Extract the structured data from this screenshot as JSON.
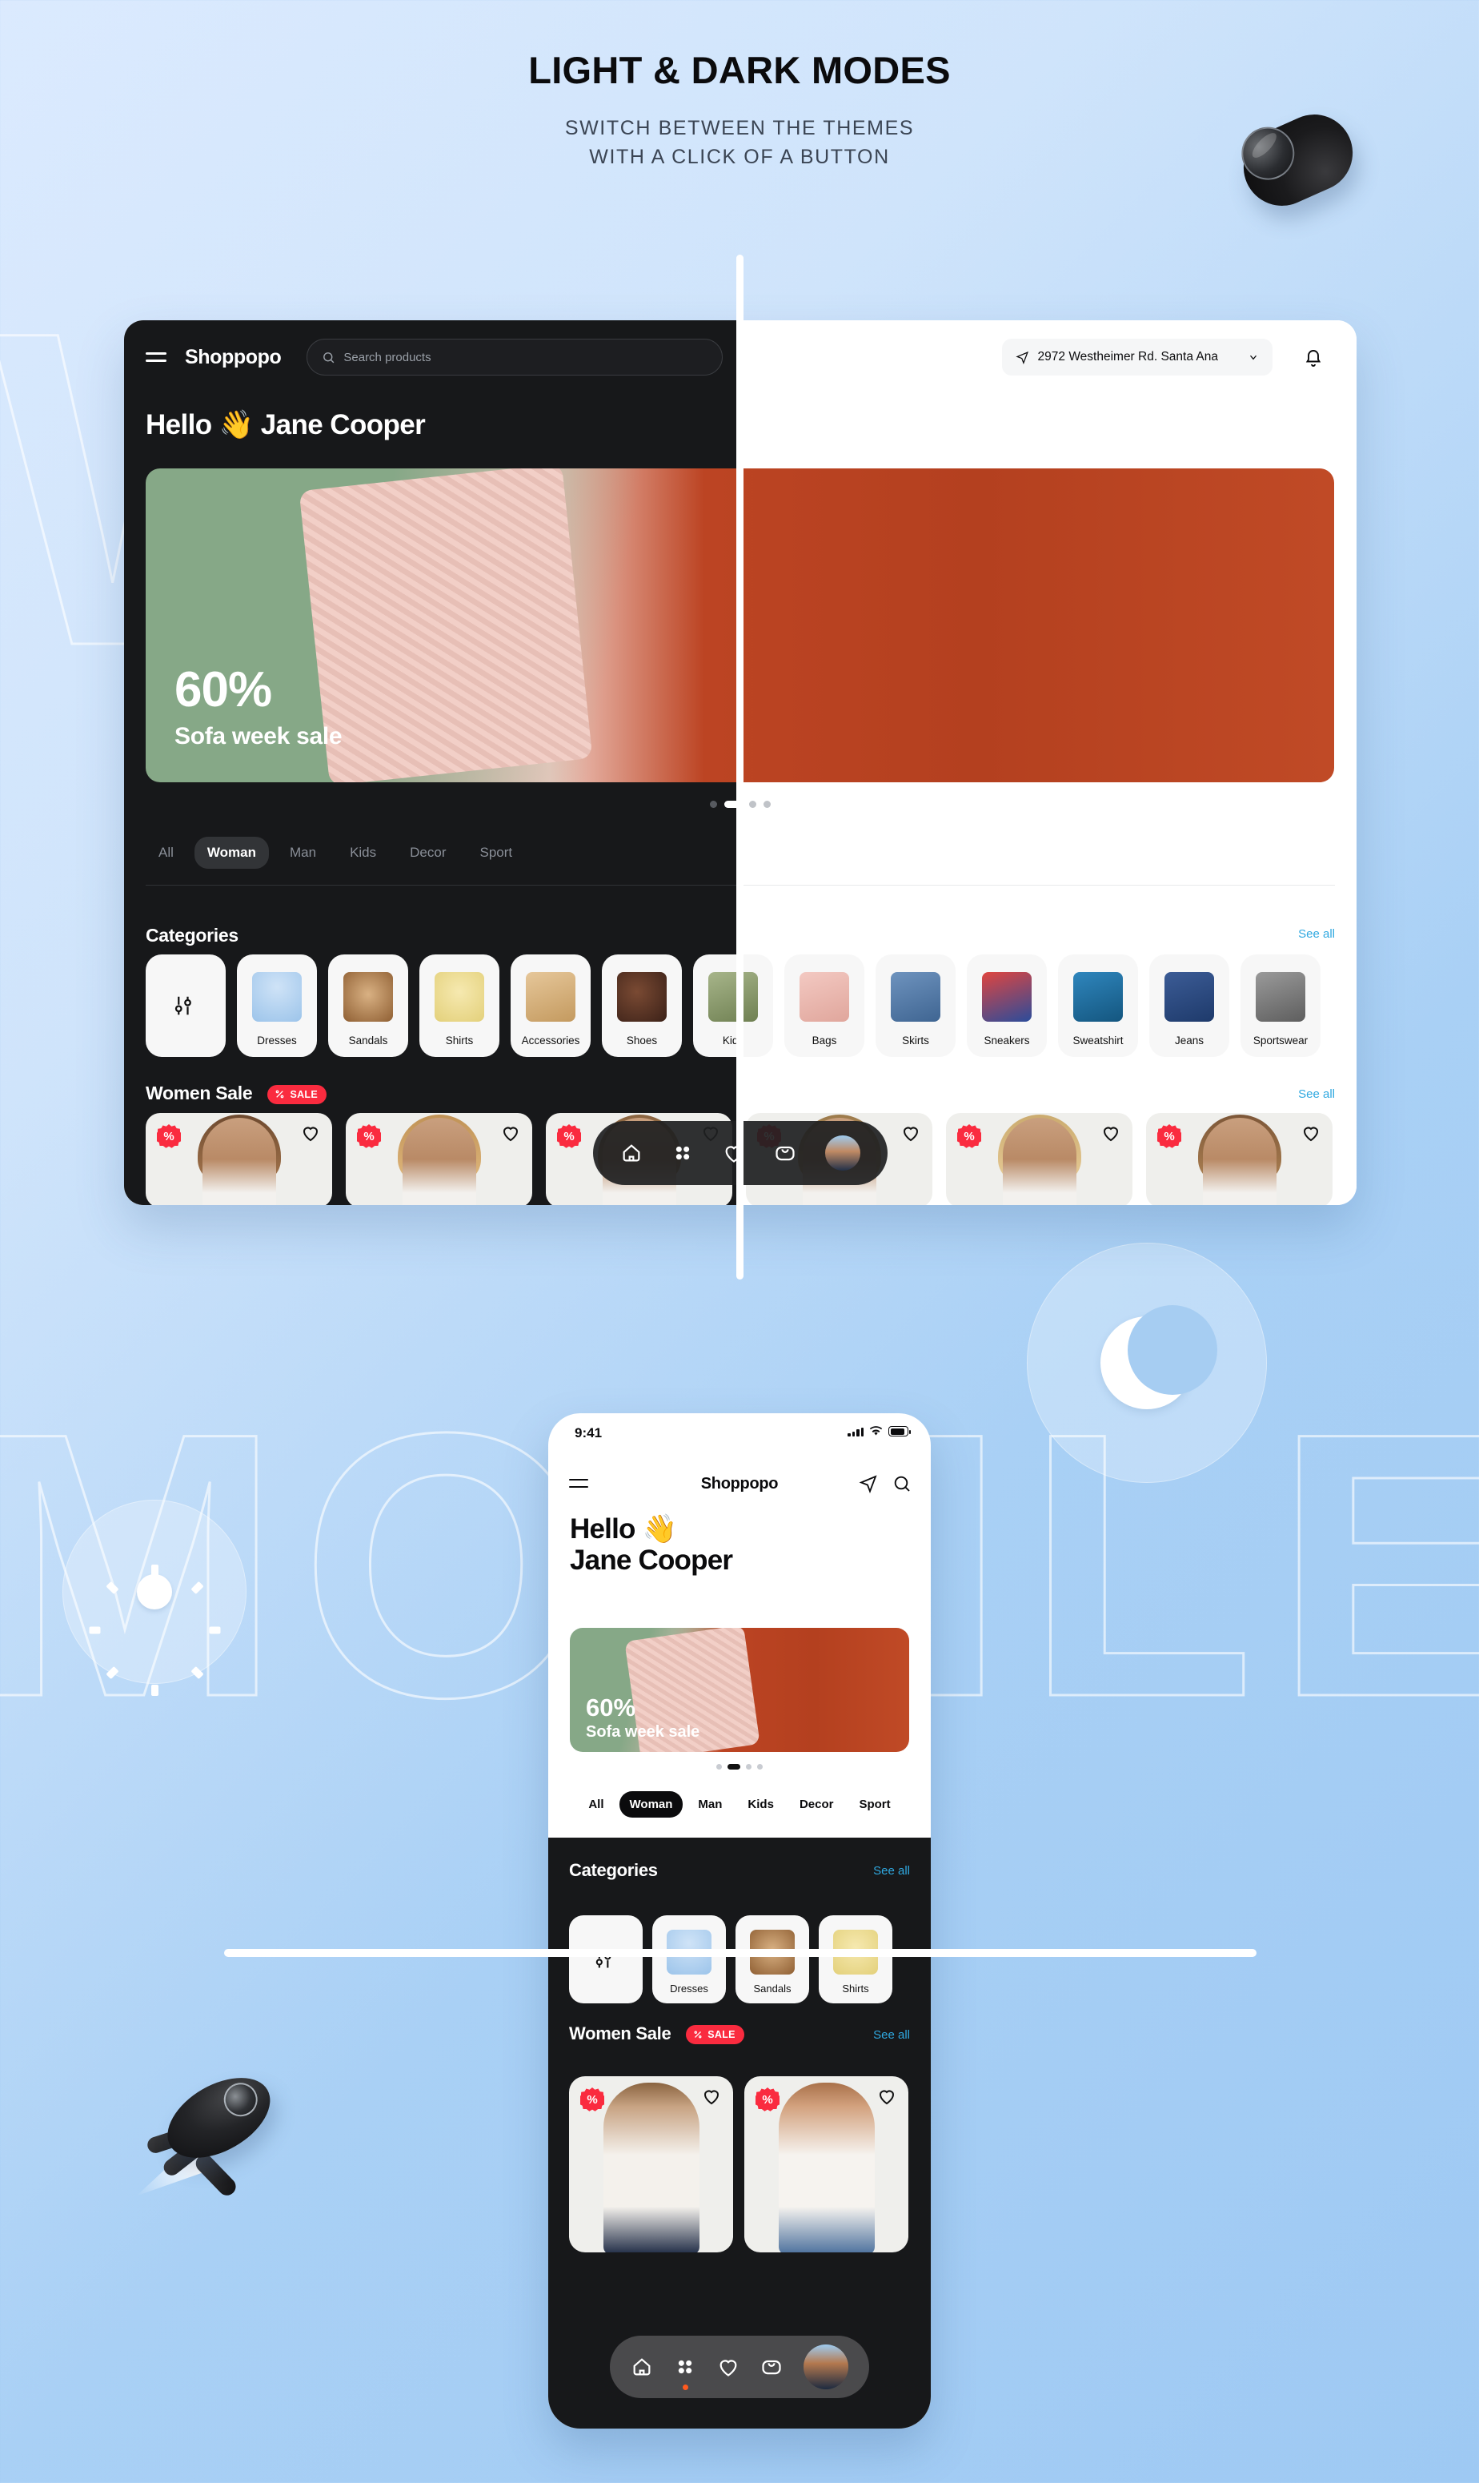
{
  "header": {
    "title": "LIGHT & DARK MODES",
    "subtitle_line1": "SWITCH BETWEEN THE THEMES",
    "subtitle_line2": "WITH A CLICK OF A BUTTON"
  },
  "background_words": {
    "top": "WEB",
    "bottom": "MOBILE"
  },
  "decorations": {
    "sun_icon": "sun-icon",
    "moon_icon": "moon-icon",
    "rocket": "rocket-illustration",
    "puck": "dark-mode-puck-illustration"
  },
  "colors": {
    "page_bg_start": "#dbeafe",
    "page_bg_end": "#9ec9f3",
    "dark_surface": "#17181a",
    "light_surface": "#ffffff",
    "accent_link": "#2fa8e0",
    "sale_red": "#fa2b3f",
    "banner_green": "#86a887",
    "banner_orange": "#bc4423"
  },
  "desktop": {
    "brand": "Shoppopo",
    "menu_icon": "hamburger-menu-icon",
    "search": {
      "icon": "search-icon",
      "placeholder": "Search products",
      "value": ""
    },
    "address": {
      "icon": "location-pin-icon",
      "text": "2972 Westheimer Rd. Santa Ana",
      "chevron": "chevron-down-icon"
    },
    "notifications_icon": "bell-icon",
    "greeting": "Hello 👋 Jane Cooper",
    "banner": {
      "percent": "60%",
      "caption": "Sofa week sale",
      "dots_total": 4,
      "active_dot": 2
    },
    "tabs": [
      {
        "label": "All",
        "active": false
      },
      {
        "label": "Woman",
        "active": true
      },
      {
        "label": "Man",
        "active": false
      },
      {
        "label": "Kids",
        "active": false
      },
      {
        "label": "Decor",
        "active": false
      },
      {
        "label": "Sport",
        "active": false
      }
    ],
    "categories_section": {
      "title": "Categories",
      "see_all": "See all",
      "items": [
        {
          "label": "",
          "icon": "filter-sliders-icon",
          "is_filter": true
        },
        {
          "label": "Dresses",
          "icon": "dress-thumbnail"
        },
        {
          "label": "Sandals",
          "icon": "sandals-thumbnail"
        },
        {
          "label": "Shirts",
          "icon": "shirt-thumbnail"
        },
        {
          "label": "Accessories",
          "icon": "accessories-thumbnail"
        },
        {
          "label": "Shoes",
          "icon": "shoes-thumbnail"
        },
        {
          "label": "Kids",
          "icon": "kids-thumbnail"
        },
        {
          "label": "Bags",
          "icon": "bag-thumbnail"
        },
        {
          "label": "Skirts",
          "icon": "skirt-thumbnail"
        },
        {
          "label": "Sneakers",
          "icon": "sneakers-thumbnail"
        },
        {
          "label": "Sweatshirt",
          "icon": "sweatshirt-thumbnail"
        },
        {
          "label": "Jeans",
          "icon": "jeans-thumbnail"
        },
        {
          "label": "Sportswear",
          "icon": "sportswear-thumbnail"
        }
      ]
    },
    "women_sale_section": {
      "title": "Women Sale",
      "badge": "SALE",
      "badge_icon": "percent-icon",
      "see_all": "See all",
      "products": [
        {
          "discount_icon": "discount-percent-badge",
          "favorite_icon": "heart-outline-icon"
        },
        {
          "discount_icon": "discount-percent-badge",
          "favorite_icon": "heart-outline-icon"
        },
        {
          "discount_icon": "discount-percent-badge",
          "favorite_icon": "heart-outline-icon"
        },
        {
          "discount_icon": "discount-percent-badge",
          "favorite_icon": "heart-outline-icon"
        },
        {
          "discount_icon": "discount-percent-badge",
          "favorite_icon": "heart-outline-icon"
        },
        {
          "discount_icon": "discount-percent-badge",
          "favorite_icon": "heart-outline-icon"
        }
      ]
    },
    "floating_nav": [
      {
        "icon": "home-icon",
        "active": true
      },
      {
        "icon": "grid-apps-icon",
        "active": false
      },
      {
        "icon": "heart-icon",
        "active": false
      },
      {
        "icon": "shopping-bag-icon",
        "active": false
      },
      {
        "icon": "avatar",
        "active": false
      }
    ]
  },
  "mobile": {
    "status_bar": {
      "time": "9:41",
      "signal_icon": "cellular-signal-icon",
      "wifi_icon": "wifi-icon",
      "battery_icon": "battery-icon"
    },
    "brand": "Shoppopo",
    "menu_icon": "hamburger-menu-icon",
    "location_icon": "location-pin-icon",
    "search_icon": "search-icon",
    "greeting_line1": "Hello 👋",
    "greeting_line2": "Jane Cooper",
    "banner": {
      "percent": "60%",
      "caption": "Sofa week sale",
      "dots_total": 4,
      "active_dot": 2
    },
    "tabs": [
      {
        "label": "All",
        "active": false
      },
      {
        "label": "Woman",
        "active": true
      },
      {
        "label": "Man",
        "active": false
      },
      {
        "label": "Kids",
        "active": false
      },
      {
        "label": "Decor",
        "active": false
      },
      {
        "label": "Sport",
        "active": false
      }
    ],
    "categories_section": {
      "title": "Categories",
      "see_all": "See all",
      "items": [
        {
          "label": "",
          "icon": "filter-sliders-icon",
          "is_filter": true
        },
        {
          "label": "Dresses",
          "icon": "dress-thumbnail"
        },
        {
          "label": "Sandals",
          "icon": "sandals-thumbnail"
        },
        {
          "label": "Shirts",
          "icon": "shirt-thumbnail"
        }
      ]
    },
    "women_sale_section": {
      "title": "Women Sale",
      "badge": "SALE",
      "badge_icon": "percent-icon",
      "see_all": "See all",
      "products": [
        {
          "discount_icon": "discount-percent-badge",
          "favorite_icon": "heart-outline-icon"
        },
        {
          "discount_icon": "discount-percent-badge",
          "favorite_icon": "heart-outline-icon"
        }
      ]
    },
    "bottom_nav": [
      {
        "icon": "home-icon",
        "active": false
      },
      {
        "icon": "grid-apps-icon",
        "active": true
      },
      {
        "icon": "heart-icon",
        "active": false
      },
      {
        "icon": "shopping-bag-icon",
        "active": false
      },
      {
        "icon": "avatar",
        "active": false
      }
    ]
  }
}
